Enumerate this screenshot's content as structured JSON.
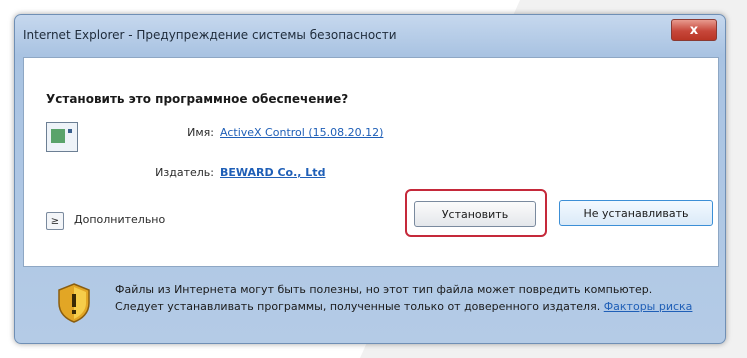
{
  "dialog": {
    "title": "Internet Explorer - Предупреждение системы безопасности",
    "close_label": "x",
    "question": "Установить это программное обеспечение?",
    "name_label": "Имя:",
    "name_value": "ActiveX Control (15.08.20.12)",
    "publisher_label": "Издатель:",
    "publisher_value": "BEWARD Co., Ltd",
    "more_label": "Дополнительно",
    "more_toggle": "≥",
    "install_button": "Установить",
    "dont_install_button": "Не устанавливать",
    "warning_text": "Файлы из Интернета могут быть полезны, но этот тип файла может повредить компьютер. Следует устанавливать программы, полученные только от доверенного издателя.",
    "warning_link": "Факторы риска"
  },
  "icons": {
    "app": "activex-component-icon",
    "warning": "security-shield-icon"
  },
  "colors": {
    "highlight": "#c5293a",
    "link": "#1f5fb7",
    "window_frame": "#a9c3e2"
  }
}
